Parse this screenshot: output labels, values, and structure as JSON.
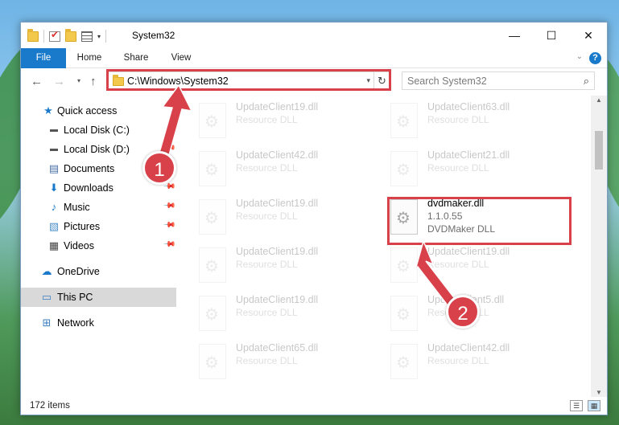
{
  "window": {
    "title": "System32",
    "controls": {
      "minimize": "—",
      "maximize": "☐",
      "close": "✕"
    }
  },
  "ribbon": {
    "tabs": [
      "File",
      "Home",
      "Share",
      "View"
    ],
    "help": "?"
  },
  "navbar": {
    "back": "←",
    "forward": "→",
    "recent": "▾",
    "up": "↑",
    "address": "C:\\Windows\\System32",
    "address_dropdown": "▾",
    "refresh": "↻",
    "search_placeholder": "Search System32",
    "search_icon": "⌕"
  },
  "sidebar": {
    "items": [
      {
        "label": "Quick access",
        "icon": "star-icon",
        "glyph": "★",
        "color": "#1979ca"
      },
      {
        "label": "Local Disk (C:)",
        "icon": "drive-icon",
        "glyph": "▬",
        "color": "#555555"
      },
      {
        "label": "Local Disk (D:)",
        "icon": "drive-icon",
        "glyph": "▬",
        "color": "#555555"
      },
      {
        "label": "Documents",
        "icon": "documents-icon",
        "glyph": "▤",
        "color": "#4a6fa5"
      },
      {
        "label": "Downloads",
        "icon": "download-icon",
        "glyph": "⬇",
        "color": "#1979ca"
      },
      {
        "label": "Music",
        "icon": "music-icon",
        "glyph": "♪",
        "color": "#1979ca"
      },
      {
        "label": "Pictures",
        "icon": "pictures-icon",
        "glyph": "▧",
        "color": "#4a8fc9"
      },
      {
        "label": "Videos",
        "icon": "videos-icon",
        "glyph": "▦",
        "color": "#444444"
      },
      {
        "label": "OneDrive",
        "icon": "cloud-icon",
        "glyph": "☁",
        "color": "#1979ca"
      },
      {
        "label": "This PC",
        "icon": "computer-icon",
        "glyph": "▭",
        "color": "#3b7fc4"
      },
      {
        "label": "Network",
        "icon": "network-icon",
        "glyph": "⊞",
        "color": "#3b7fc4"
      }
    ]
  },
  "files": [
    {
      "name": "UpdateClient19.dll",
      "desc": "Resource DLL"
    },
    {
      "name": "UpdateClient63.dll",
      "desc": "Resource DLL"
    },
    {
      "name": "UpdateClient42.dll",
      "desc": "Resource DLL"
    },
    {
      "name": "UpdateClient21.dll",
      "desc": "Resource DLL"
    },
    {
      "name": "UpdateClient19.dll",
      "desc": "Resource DLL"
    },
    {
      "name": "dvdmaker.dll",
      "version": "1.1.0.55",
      "desc": "DVDMaker DLL"
    },
    {
      "name": "UpdateClient19.dll",
      "desc": "Resource DLL"
    },
    {
      "name": "UpdateClient19.dll",
      "desc": "Resource DLL"
    },
    {
      "name": "UpdateClient19.dll",
      "desc": "Resource DLL"
    },
    {
      "name": "UpdateClient5.dll",
      "desc": "Resource DLL"
    },
    {
      "name": "UpdateClient65.dll",
      "desc": "Resource DLL"
    },
    {
      "name": "UpdateClient42.dll",
      "desc": "Resource DLL"
    }
  ],
  "status": {
    "item_count": "172 items"
  },
  "annotations": {
    "step1": "1",
    "step2": "2",
    "color": "#d9414a"
  }
}
